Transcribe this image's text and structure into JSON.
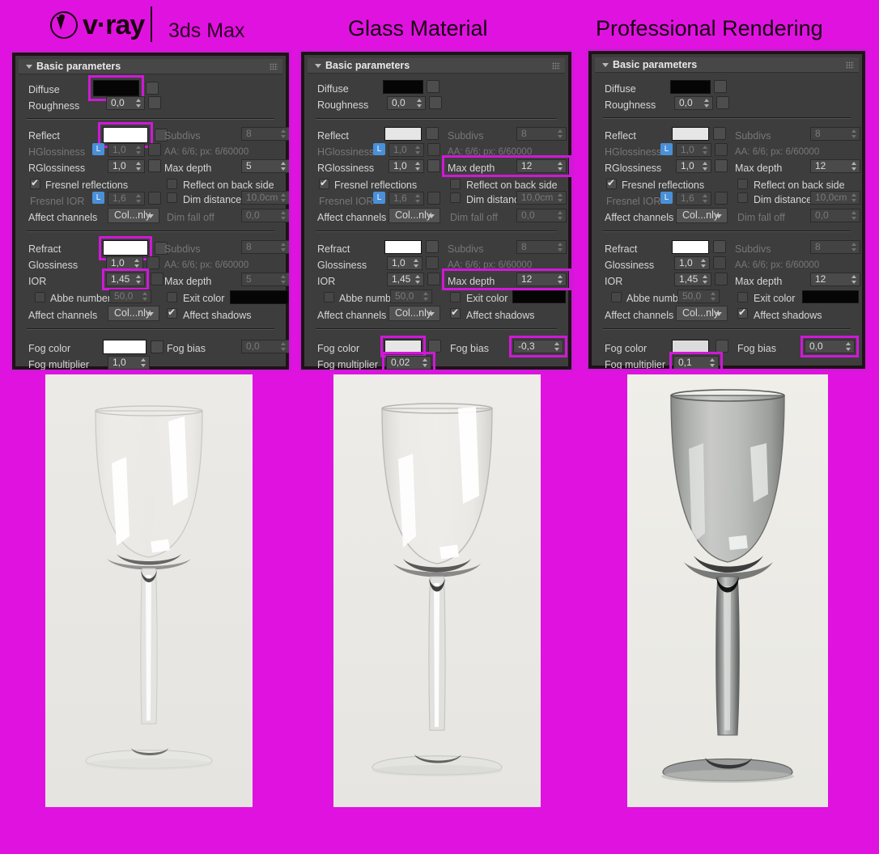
{
  "header": {
    "brand": "v·ray",
    "product": "3ds Max",
    "title_center": "Glass Material",
    "title_right": "Professional Rendering",
    "background_color": "#e012e0",
    "text_color": "#150010"
  },
  "common": {
    "rollout_title": "Basic parameters",
    "labels": {
      "diffuse": "Diffuse",
      "roughness": "Roughness",
      "reflect": "Reflect",
      "hglossiness": "HGlossiness",
      "rglossiness": "RGlossiness",
      "subdivs": "Subdivs",
      "aa_info": "AA: 6/6; px: 6/60000",
      "max_depth": "Max depth",
      "fresnel_reflections": "Fresnel reflections",
      "reflect_on_back_side": "Reflect on back side",
      "fresnel_ior": "Fresnel IOR",
      "dim_distance": "Dim distance",
      "affect_channels": "Affect channels",
      "dim_fall_off": "Dim fall off",
      "refract": "Refract",
      "glossiness": "Glossiness",
      "ior": "IOR",
      "abbe_number": "Abbe number",
      "exit_color": "Exit color",
      "affect_shadows": "Affect shadows",
      "fog_color": "Fog color",
      "fog_bias": "Fog bias",
      "fog_multiplier": "Fog multiplier",
      "lock_badge": "L",
      "affect_channels_value": "Col...nly"
    },
    "highlight_color": "#d018d8"
  },
  "panels": [
    {
      "id": "panel-1",
      "diffuse_color": "#050505",
      "roughness": "0,0",
      "reflect_color": "#ffffff",
      "hglossiness": "1,0",
      "rglossiness": "1,0",
      "reflect_subdivs": "8",
      "reflect_max_depth": "5",
      "fresnel_ior": "1,6",
      "dim_distance": "10,0cm",
      "dim_fall_off": "0,0",
      "affect_channels": "Col...nly",
      "refract_color": "#ffffff",
      "glossiness": "1,0",
      "ior": "1,45",
      "abbe_number": "50,0",
      "refract_subdivs": "8",
      "refract_max_depth": "5",
      "exit_color": "#050505",
      "refract_affect_channels": "Col...nly",
      "fog_color": "#ffffff",
      "fog_bias": "0,0",
      "fog_multiplier": "1,0",
      "highlighted": [
        "diffuse-swatch",
        "reflect-swatch",
        "refract-swatch",
        "ior-spinner"
      ]
    },
    {
      "id": "panel-2",
      "diffuse_color": "#050505",
      "roughness": "0,0",
      "reflect_color": "#eeeeee",
      "hglossiness": "1,0",
      "rglossiness": "1,0",
      "reflect_subdivs": "8",
      "reflect_max_depth": "12",
      "fresnel_ior": "1,6",
      "dim_distance": "10,0cm",
      "dim_fall_off": "0,0",
      "affect_channels": "Col...nly",
      "refract_color": "#ffffff",
      "glossiness": "1,0",
      "ior": "1,45",
      "abbe_number": "50,0",
      "refract_subdivs": "8",
      "refract_max_depth": "12",
      "exit_color": "#050505",
      "refract_affect_channels": "Col...nly",
      "fog_color": "#e6e6e6",
      "fog_bias": "-0,3",
      "fog_multiplier": "0,02",
      "highlighted": [
        "reflect-max-depth",
        "refract-max-depth",
        "fog-color-swatch",
        "fog-bias",
        "fog-multiplier"
      ]
    },
    {
      "id": "panel-3",
      "diffuse_color": "#050505",
      "roughness": "0,0",
      "reflect_color": "#eeeeee",
      "hglossiness": "1,0",
      "rglossiness": "1,0",
      "reflect_subdivs": "8",
      "reflect_max_depth": "12",
      "fresnel_ior": "1,6",
      "dim_distance": "10,0cm",
      "dim_fall_off": "0,0",
      "affect_channels": "Col...nly",
      "refract_color": "#ffffff",
      "glossiness": "1,0",
      "ior": "1,45",
      "abbe_number": "50,0",
      "refract_subdivs": "8",
      "refract_max_depth": "12",
      "exit_color": "#050505",
      "refract_affect_channels": "Col...nly",
      "fog_color": "#dcdcdc",
      "fog_bias": "0,0",
      "fog_multiplier": "0,1",
      "highlighted": [
        "fog-bias",
        "fog-multiplier"
      ]
    }
  ],
  "renders": [
    {
      "id": "render-1",
      "description": "clear wine glass",
      "glass_tint": "#f2f2f0",
      "glass_opacity": 0.1,
      "background": "#e9e9e6"
    },
    {
      "id": "render-2",
      "description": "slightly tinted wine glass",
      "glass_tint": "#dedede",
      "glass_opacity": 0.28,
      "background": "#eceae6"
    },
    {
      "id": "render-3",
      "description": "smoky dark wine glass",
      "glass_tint": "#8f9190",
      "glass_opacity": 0.75,
      "background": "#ecebe7"
    }
  ]
}
